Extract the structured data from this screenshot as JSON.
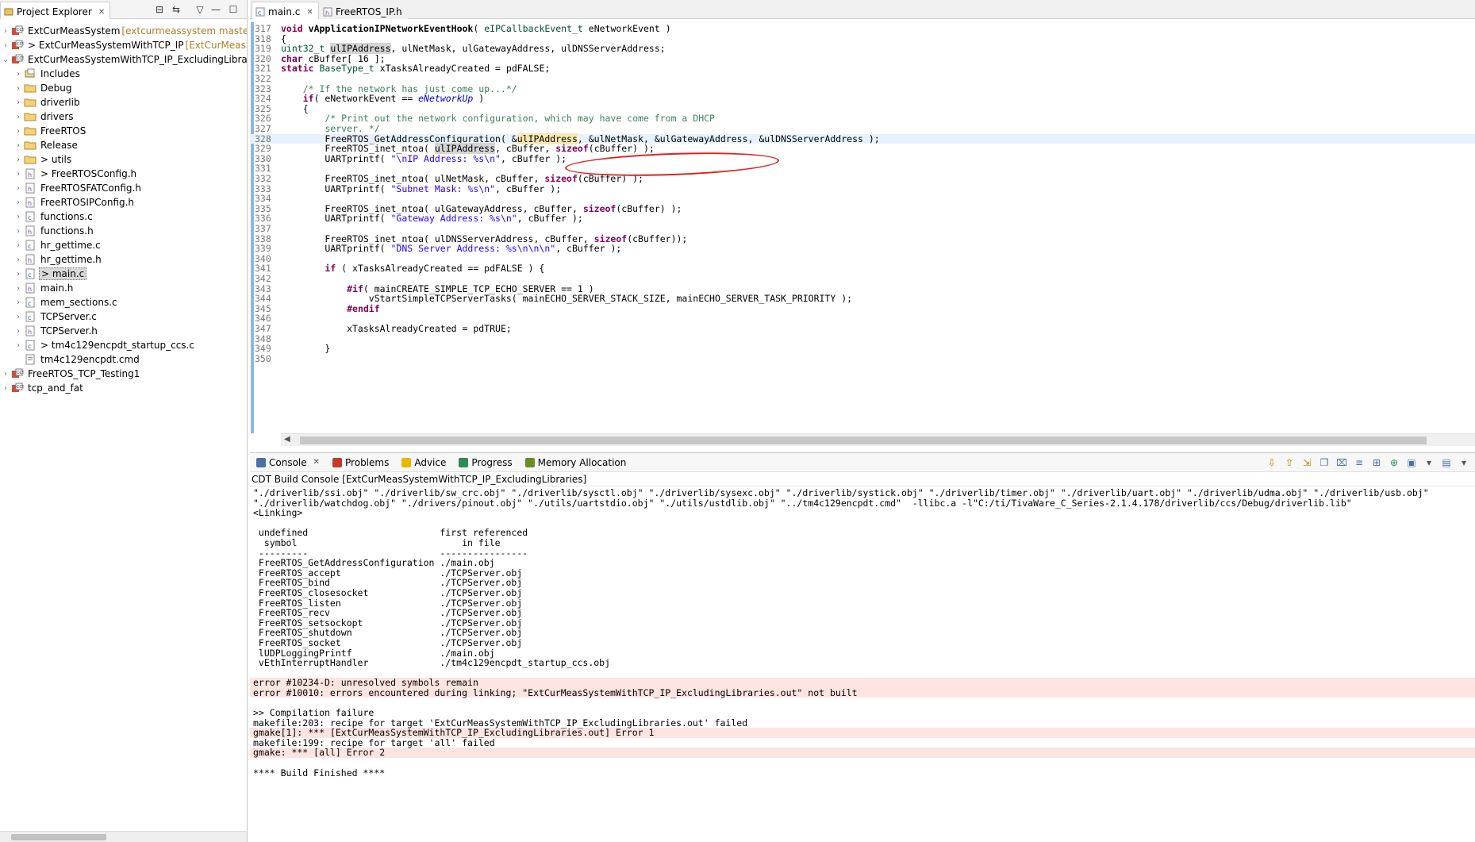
{
  "explorer": {
    "title": "Project Explorer",
    "items": [
      {
        "label": "ExtCurMeasSystem",
        "suffix": " [extcurmeassystem master]",
        "depth": 0,
        "chevron": "›",
        "icon": "ccs-project-icon"
      },
      {
        "label": "> ExtCurMeasSystemWithTCP_IP",
        "suffix": " [ExtCurMeasSyster",
        "depth": 0,
        "chevron": "›",
        "icon": "ccs-project-icon"
      },
      {
        "label": "ExtCurMeasSystemWithTCP_IP_ExcludingLibraries",
        "suffix": "",
        "depth": 0,
        "chevron": "⌄",
        "icon": "ccs-project-icon"
      },
      {
        "label": "Includes",
        "suffix": "",
        "depth": 1,
        "chevron": "›",
        "icon": "includes-icon"
      },
      {
        "label": "Debug",
        "suffix": "",
        "depth": 1,
        "chevron": "›",
        "icon": "folder-icon"
      },
      {
        "label": "driverlib",
        "suffix": "",
        "depth": 1,
        "chevron": "›",
        "icon": "folder-icon"
      },
      {
        "label": "drivers",
        "suffix": "",
        "depth": 1,
        "chevron": "›",
        "icon": "folder-icon"
      },
      {
        "label": "FreeRTOS",
        "suffix": "",
        "depth": 1,
        "chevron": "›",
        "icon": "folder-icon"
      },
      {
        "label": "Release",
        "suffix": "",
        "depth": 1,
        "chevron": "›",
        "icon": "folder-icon"
      },
      {
        "label": "> utils",
        "suffix": "",
        "depth": 1,
        "chevron": "›",
        "icon": "folder-icon"
      },
      {
        "label": "> FreeRTOSConfig.h",
        "suffix": "",
        "depth": 1,
        "chevron": "›",
        "icon": "h-file-icon"
      },
      {
        "label": "FreeRTOSFATConfig.h",
        "suffix": "",
        "depth": 1,
        "chevron": "›",
        "icon": "h-file-icon"
      },
      {
        "label": "FreeRTOSIPConfig.h",
        "suffix": "",
        "depth": 1,
        "chevron": "›",
        "icon": "h-file-icon"
      },
      {
        "label": "functions.c",
        "suffix": "",
        "depth": 1,
        "chevron": "›",
        "icon": "c-file-icon"
      },
      {
        "label": "functions.h",
        "suffix": "",
        "depth": 1,
        "chevron": "›",
        "icon": "h-file-icon"
      },
      {
        "label": "hr_gettime.c",
        "suffix": "",
        "depth": 1,
        "chevron": "›",
        "icon": "c-file-icon"
      },
      {
        "label": "hr_gettime.h",
        "suffix": "",
        "depth": 1,
        "chevron": "›",
        "icon": "h-file-icon"
      },
      {
        "label": "> main.c",
        "suffix": "",
        "depth": 1,
        "chevron": "›",
        "icon": "c-file-icon",
        "selected": true
      },
      {
        "label": "main.h",
        "suffix": "",
        "depth": 1,
        "chevron": "›",
        "icon": "h-file-icon"
      },
      {
        "label": "mem_sections.c",
        "suffix": "",
        "depth": 1,
        "chevron": "›",
        "icon": "c-file-icon"
      },
      {
        "label": "TCPServer.c",
        "suffix": "",
        "depth": 1,
        "chevron": "›",
        "icon": "c-file-icon"
      },
      {
        "label": "TCPServer.h",
        "suffix": "",
        "depth": 1,
        "chevron": "›",
        "icon": "h-file-icon"
      },
      {
        "label": "> tm4c129encpdt_startup_ccs.c",
        "suffix": "",
        "depth": 1,
        "chevron": "›",
        "icon": "c-file-icon"
      },
      {
        "label": "tm4c129encpdt.cmd",
        "suffix": "",
        "depth": 1,
        "chevron": "",
        "icon": "cmd-file-icon"
      },
      {
        "label": "FreeRTOS_TCP_Testing1",
        "suffix": "",
        "depth": 0,
        "chevron": "›",
        "icon": "ccs-project-icon"
      },
      {
        "label": "tcp_and_fat",
        "suffix": "",
        "depth": 0,
        "chevron": "›",
        "icon": "ccs-project-icon"
      }
    ]
  },
  "editor": {
    "tabs": [
      {
        "label": "main.c",
        "active": true
      },
      {
        "label": "FreeRTOS_IP.h",
        "active": false
      }
    ],
    "current_line": 328,
    "lines": [
      {
        "n": "317",
        "html": "<span class=\"kw\">void</span> <b>vApplicationIPNetworkEventHook</b>( <span class=\"ty\">eIPCallbackEvent_t</span> eNetworkEvent )"
      },
      {
        "n": "318",
        "html": "{"
      },
      {
        "n": "319",
        "html": "<span class=\"ty\">uint32_t</span> <span class=\"hl\">ulIPAddress</span>, ulNetMask, ulGatewayAddress, ulDNSServerAddress;"
      },
      {
        "n": "320",
        "html": "<span class=\"kw\">char</span> cBuffer[ 16 ];"
      },
      {
        "n": "321",
        "html": "<span class=\"kw\">static</span> <span class=\"ty\">BaseType_t</span> xTasksAlreadyCreated = pdFALSE;"
      },
      {
        "n": "322",
        "html": ""
      },
      {
        "n": "323",
        "html": "    <span class=\"cm\">/* If the network has just come up...*/</span>"
      },
      {
        "n": "324",
        "html": "    <span class=\"kw\">if</span>( eNetworkEvent == <span class=\"en\">eNetworkUp</span> )"
      },
      {
        "n": "325",
        "html": "    {"
      },
      {
        "n": "326",
        "html": "        <span class=\"cm\">/* Print out the network configuration, which may have come from a DHCP</span>"
      },
      {
        "n": "327",
        "html": "        <span class=\"cm\">server. */</span>"
      },
      {
        "n": "328",
        "html": "        FreeRTOS_GetAddressConfiguration( &amp;<span class=\"hlo\">ulIPAddress</span>, &amp;ulNetMask, &amp;ulGatewayAddress, &amp;ulDNSServerAddress );"
      },
      {
        "n": "329",
        "html": "        FreeRTOS_inet_ntoa( <span class=\"hl\">ulIPAddress</span>, cBuffer, <span class=\"kw\">sizeof</span>(cBuffer) );"
      },
      {
        "n": "330",
        "html": "        UARTprintf( <span class=\"st\">\"\\nIP Address: %s\\n\"</span>, cBuffer );"
      },
      {
        "n": "331",
        "html": ""
      },
      {
        "n": "332",
        "html": "        FreeRTOS_inet_ntoa( ulNetMask, cBuffer, <span class=\"kw\">sizeof</span>(cBuffer) );"
      },
      {
        "n": "333",
        "html": "        UARTprintf( <span class=\"st\">\"Subnet Mask: %s\\n\"</span>, cBuffer );"
      },
      {
        "n": "334",
        "html": ""
      },
      {
        "n": "335",
        "html": "        FreeRTOS_inet_ntoa( ulGatewayAddress, cBuffer, <span class=\"kw\">sizeof</span>(cBuffer) );"
      },
      {
        "n": "336",
        "html": "        UARTprintf( <span class=\"st\">\"Gateway Address: %s\\n\"</span>, cBuffer );"
      },
      {
        "n": "337",
        "html": ""
      },
      {
        "n": "338",
        "html": "        FreeRTOS_inet_ntoa( ulDNSServerAddress, cBuffer, <span class=\"kw\">sizeof</span>(cBuffer));"
      },
      {
        "n": "339",
        "html": "        UARTprintf( <span class=\"st\">\"DNS Server Address: %s\\n\\n\\n\"</span>, cBuffer );"
      },
      {
        "n": "340",
        "html": ""
      },
      {
        "n": "341",
        "html": "        <span class=\"kw\">if</span> ( xTasksAlreadyCreated == pdFALSE ) {"
      },
      {
        "n": "342",
        "html": ""
      },
      {
        "n": "343",
        "html": "            <span class=\"pp\">#if</span>( mainCREATE_SIMPLE_TCP_ECHO_SERVER == 1 )"
      },
      {
        "n": "344",
        "html": "                vStartSimpleTCPServerTasks( mainECHO_SERVER_STACK_SIZE, mainECHO_SERVER_TASK_PRIORITY );"
      },
      {
        "n": "345",
        "html": "            <span class=\"pp\">#endif</span>"
      },
      {
        "n": "346",
        "html": ""
      },
      {
        "n": "347",
        "html": "            xTasksAlreadyCreated = pdTRUE;"
      },
      {
        "n": "348",
        "html": ""
      },
      {
        "n": "349",
        "html": "        }"
      },
      {
        "n": "350",
        "html": ""
      }
    ]
  },
  "console": {
    "tabs": [
      {
        "label": "Console",
        "name": "console",
        "color": "#4a6fa5",
        "active": true
      },
      {
        "label": "Problems",
        "name": "problems",
        "color": "#c0392b"
      },
      {
        "label": "Advice",
        "name": "advice",
        "color": "#e6b800"
      },
      {
        "label": "Progress",
        "name": "progress",
        "color": "#2e8b57"
      },
      {
        "label": "Memory Allocation",
        "name": "memory-allocation",
        "color": "#6b8e23"
      }
    ],
    "title": "CDT Build Console [ExtCurMeasSystemWithTCP_IP_ExcludingLibraries]",
    "lines": [
      {
        "text": "\"./driverlib/ssi.obj\" \"./driverlib/sw_crc.obj\" \"./driverlib/sysctl.obj\" \"./driverlib/sysexc.obj\" \"./driverlib/systick.obj\" \"./driverlib/timer.obj\" \"./driverlib/uart.obj\" \"./driverlib/udma.obj\" \"./driverlib/usb.obj\"",
        "err": false
      },
      {
        "text": "\"./driverlib/watchdog.obj\" \"./drivers/pinout.obj\" \"./utils/uartstdio.obj\" \"./utils/ustdlib.obj\" \"../tm4c129encpdt.cmd\"  -llibc.a -l\"C:/ti/TivaWare_C_Series-2.1.4.178/driverlib/ccs/Debug/driverlib.lib\"",
        "err": false
      },
      {
        "text": "<Linking>",
        "err": false
      },
      {
        "text": "",
        "err": false
      },
      {
        "text": " undefined                        first referenced",
        "err": false
      },
      {
        "text": "  symbol                              in file",
        "err": false
      },
      {
        "text": " ---------                        ----------------",
        "err": false
      },
      {
        "text": " FreeRTOS_GetAddressConfiguration ./main.obj",
        "err": false
      },
      {
        "text": " FreeRTOS_accept                  ./TCPServer.obj",
        "err": false
      },
      {
        "text": " FreeRTOS_bind                    ./TCPServer.obj",
        "err": false
      },
      {
        "text": " FreeRTOS_closesocket             ./TCPServer.obj",
        "err": false
      },
      {
        "text": " FreeRTOS_listen                  ./TCPServer.obj",
        "err": false
      },
      {
        "text": " FreeRTOS_recv                    ./TCPServer.obj",
        "err": false
      },
      {
        "text": " FreeRTOS_setsockopt              ./TCPServer.obj",
        "err": false
      },
      {
        "text": " FreeRTOS_shutdown                ./TCPServer.obj",
        "err": false
      },
      {
        "text": " FreeRTOS_socket                  ./TCPServer.obj",
        "err": false
      },
      {
        "text": " lUDPLoggingPrintf                ./main.obj",
        "err": false
      },
      {
        "text": " vEthInterruptHandler             ./tm4c129encpdt_startup_ccs.obj",
        "err": false
      },
      {
        "text": "",
        "err": false
      },
      {
        "text": "error #10234-D: unresolved symbols remain",
        "err": true
      },
      {
        "text": "error #10010: errors encountered during linking; \"ExtCurMeasSystemWithTCP_IP_ExcludingLibraries.out\" not built",
        "err": true
      },
      {
        "text": "",
        "err": false
      },
      {
        "text": ">> Compilation failure",
        "err": false
      },
      {
        "text": "makefile:203: recipe for target 'ExtCurMeasSystemWithTCP_IP_ExcludingLibraries.out' failed",
        "err": false
      },
      {
        "text": "gmake[1]: *** [ExtCurMeasSystemWithTCP_IP_ExcludingLibraries.out] Error 1",
        "err": true
      },
      {
        "text": "makefile:199: recipe for target 'all' failed",
        "err": false
      },
      {
        "text": "gmake: *** [all] Error 2",
        "err": true
      },
      {
        "text": "",
        "err": false
      },
      {
        "text": "**** Build Finished ****",
        "err": false
      }
    ]
  }
}
